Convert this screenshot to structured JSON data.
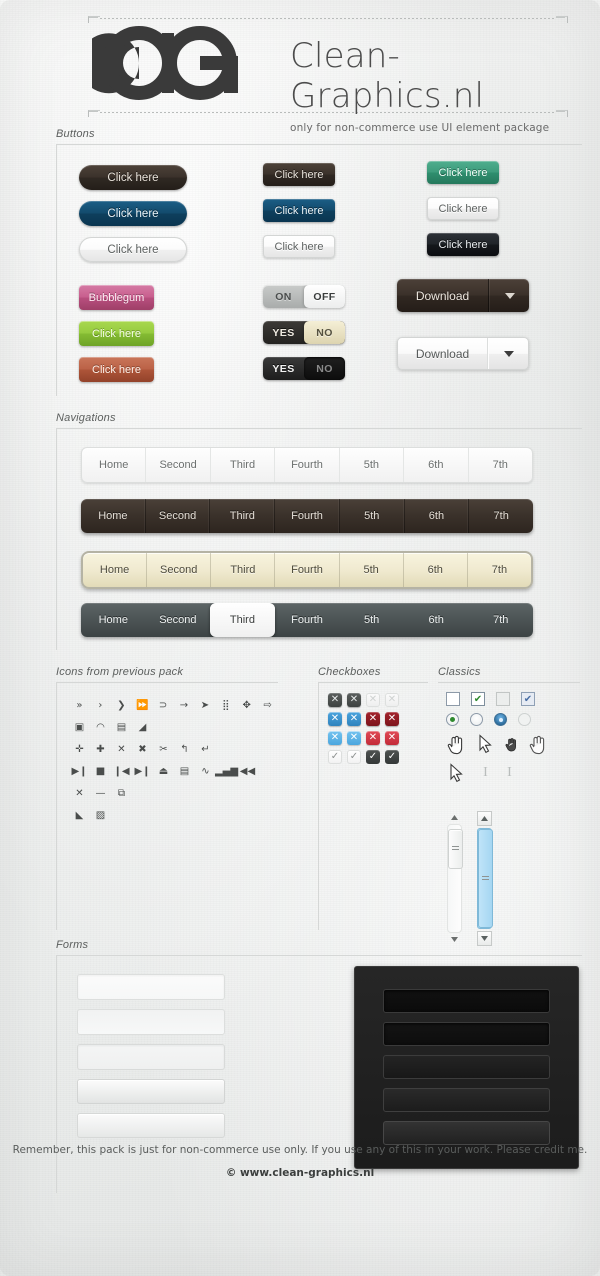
{
  "brand": {
    "title": "Clean-Graphics.nl",
    "subtitle": "only for non-commerce use UI element package",
    "logo_icon": "cg-monogram-logo"
  },
  "sections": {
    "buttons": "Buttons",
    "navigations": "Navigations",
    "icons": "Icons from previous pack",
    "checkboxes": "Checkboxes",
    "classics": "Classics",
    "forms": "Forms"
  },
  "buttons": {
    "col1": [
      {
        "label": "Click here",
        "style": "pill-dark-brown"
      },
      {
        "label": "Click here",
        "style": "pill-dark-blue"
      },
      {
        "label": "Click here",
        "style": "pill-white"
      },
      {
        "label": "Bubblegum",
        "style": "rect-bubblegum"
      },
      {
        "label": "Click here",
        "style": "rect-limegreen"
      },
      {
        "label": "Click here",
        "style": "rect-rust"
      }
    ],
    "col2": [
      {
        "label": "Click here",
        "style": "rect-dark-brown"
      },
      {
        "label": "Click here",
        "style": "rect-dark-blue"
      },
      {
        "label": "Click here",
        "style": "rect-white"
      }
    ],
    "col3": [
      {
        "label": "Click here",
        "style": "rect-teal"
      },
      {
        "label": "Click here",
        "style": "rect-white"
      },
      {
        "label": "Click here",
        "style": "rect-near-black"
      }
    ],
    "toggles": [
      {
        "left": "ON",
        "right": "OFF",
        "selected": "right",
        "style": "grey"
      },
      {
        "left": "YES",
        "right": "NO",
        "selected": "right",
        "style": "cream"
      },
      {
        "left": "YES",
        "right": "NO",
        "selected": "right",
        "style": "black"
      }
    ],
    "split_buttons": [
      {
        "label": "Download",
        "style": "dark",
        "caret_icon": "chevron-down-icon"
      },
      {
        "label": "Download",
        "style": "light",
        "caret_icon": "chevron-down-icon"
      }
    ]
  },
  "navigations": {
    "items": [
      "Home",
      "Second",
      "Third",
      "Fourth",
      "5th",
      "6th",
      "7th"
    ],
    "bars": [
      {
        "style": "white",
        "active": null
      },
      {
        "style": "brown",
        "active": null
      },
      {
        "style": "cream",
        "active": null
      },
      {
        "style": "slate",
        "active": "Third"
      }
    ]
  },
  "icons": {
    "rows": [
      [
        "»",
        "›",
        "❯",
        "⏩",
        "⊃",
        "→",
        "➤",
        "⣿",
        "✥",
        "⇨"
      ],
      [
        "▣",
        "◠",
        "▤",
        "◢"
      ],
      [
        "✛",
        "✚",
        "✕",
        "✖",
        "✂",
        "↰",
        "↵"
      ],
      [
        "▶❙",
        "■",
        "❙◀",
        "▶❙",
        "⏏",
        "▤",
        "∿",
        "▂▄▆",
        "◀◀"
      ],
      [
        "✕",
        "—",
        "⧉"
      ],
      [
        "◣",
        "▨"
      ]
    ]
  },
  "checkboxes": {
    "rows": [
      [
        {
          "glyph": "✕",
          "style": "dark"
        },
        {
          "glyph": "✕",
          "style": "dark"
        },
        {
          "glyph": "✕",
          "style": "pale"
        },
        {
          "glyph": "✕",
          "style": "pale"
        }
      ],
      [
        {
          "glyph": "✕",
          "style": "blue"
        },
        {
          "glyph": "✕",
          "style": "blue"
        },
        {
          "glyph": "✕",
          "style": "red"
        },
        {
          "glyph": "✕",
          "style": "red"
        }
      ],
      [
        {
          "glyph": "✕",
          "style": "blue2"
        },
        {
          "glyph": "✕",
          "style": "blue2"
        },
        {
          "glyph": "✕",
          "style": "red2"
        },
        {
          "glyph": "✕",
          "style": "red2"
        }
      ],
      [
        {
          "glyph": "✓",
          "style": "wht"
        },
        {
          "glyph": "✓",
          "style": "wht"
        },
        {
          "glyph": "✓",
          "style": "chk"
        },
        {
          "glyph": "✓",
          "style": "chk"
        }
      ]
    ]
  },
  "classics": {
    "checkbox_row": [
      {
        "glyph": "",
        "style": "plain"
      },
      {
        "glyph": "✔",
        "style": "green"
      },
      {
        "glyph": "",
        "style": "disabled"
      },
      {
        "glyph": "✔",
        "style": "blue"
      }
    ],
    "radio_row": [
      {
        "state": "on-green"
      },
      {
        "state": "off"
      },
      {
        "state": "on-blue"
      },
      {
        "state": "disabled"
      }
    ],
    "cursor_row_1": [
      "hand-pointer-icon",
      "arrow-pointer-icon",
      "hand-link-icon",
      "hand-grab-icon"
    ],
    "cursor_row_2": [
      "arrow-pointer-icon",
      "text-ibeam-icon",
      "text-ibeam-icon"
    ],
    "scrollbars": [
      {
        "style": "light",
        "up_icon": "caret-up-icon",
        "down_icon": "caret-down-icon",
        "thumb_grip": "grip-lines-icon"
      },
      {
        "style": "blue",
        "up_icon": "caret-up-icon",
        "down_icon": "caret-down-icon",
        "thumb_grip": "grip-lines-icon"
      }
    ]
  },
  "forms": {
    "light_fields": [
      "field-1",
      "field-2",
      "field-3",
      "field-4",
      "field-5"
    ],
    "dark_fields": [
      "dark-field-1",
      "dark-field-2",
      "dark-field-3",
      "dark-field-4",
      "dark-field-5"
    ]
  },
  "footer": {
    "note": "Remember, this pack is just for non-commerce use only. If you use any of this in your work. Please credit me.",
    "copyright": "© www.clean-graphics.nl"
  }
}
